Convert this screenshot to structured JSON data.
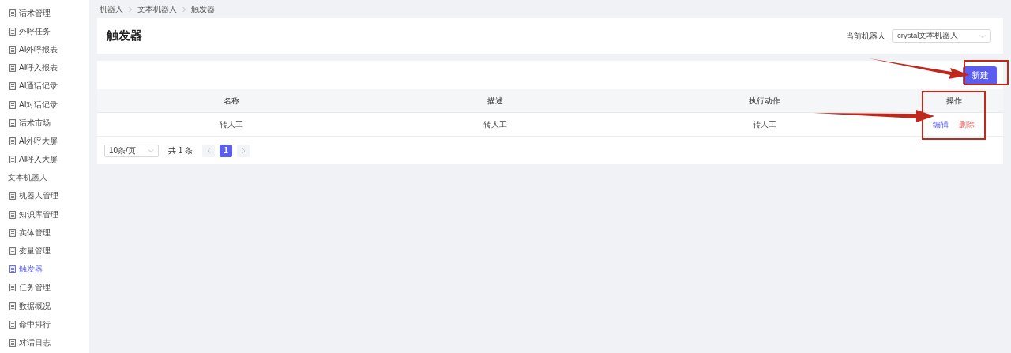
{
  "sidebar": {
    "items": [
      {
        "kind": "item",
        "label": "话术管理",
        "selected": false
      },
      {
        "kind": "item",
        "label": "外呼任务",
        "selected": false
      },
      {
        "kind": "item",
        "label": "AI外呼报表",
        "selected": false
      },
      {
        "kind": "item",
        "label": "AI呼入报表",
        "selected": false
      },
      {
        "kind": "item",
        "label": "AI通话记录",
        "selected": false
      },
      {
        "kind": "item",
        "label": "AI对话记录",
        "selected": false
      },
      {
        "kind": "item",
        "label": "话术市场",
        "selected": false
      },
      {
        "kind": "item",
        "label": "AI外呼大屏",
        "selected": false
      },
      {
        "kind": "item",
        "label": "AI呼入大屏",
        "selected": false
      },
      {
        "kind": "group",
        "label": "文本机器人"
      },
      {
        "kind": "item",
        "label": "机器人管理",
        "selected": false
      },
      {
        "kind": "item",
        "label": "知识库管理",
        "selected": false
      },
      {
        "kind": "item",
        "label": "实体管理",
        "selected": false
      },
      {
        "kind": "item",
        "label": "变量管理",
        "selected": false
      },
      {
        "kind": "item",
        "label": "触发器",
        "selected": true
      },
      {
        "kind": "item",
        "label": "任务管理",
        "selected": false
      },
      {
        "kind": "item",
        "label": "数据概况",
        "selected": false
      },
      {
        "kind": "item",
        "label": "命中排行",
        "selected": false
      },
      {
        "kind": "item",
        "label": "对话日志",
        "selected": false
      }
    ]
  },
  "breadcrumb": [
    "机器人",
    "文本机器人",
    "触发器"
  ],
  "header": {
    "title": "触发器",
    "robot_label": "当前机器人",
    "robot_select": "crystal文本机器人"
  },
  "toolbar": {
    "new_button": "新建"
  },
  "table": {
    "columns": [
      "名称",
      "描述",
      "执行动作",
      "操作"
    ],
    "rows": [
      {
        "cells": [
          "转人工",
          "转人工",
          "转人工"
        ],
        "actions": [
          {
            "label": "编辑",
            "kind": "edit"
          },
          {
            "label": "删除",
            "kind": "delete"
          }
        ]
      }
    ]
  },
  "pagination": {
    "page_size": "10条/页",
    "total": "共 1 条",
    "pages": [
      {
        "label": "1",
        "selected": true
      }
    ]
  }
}
